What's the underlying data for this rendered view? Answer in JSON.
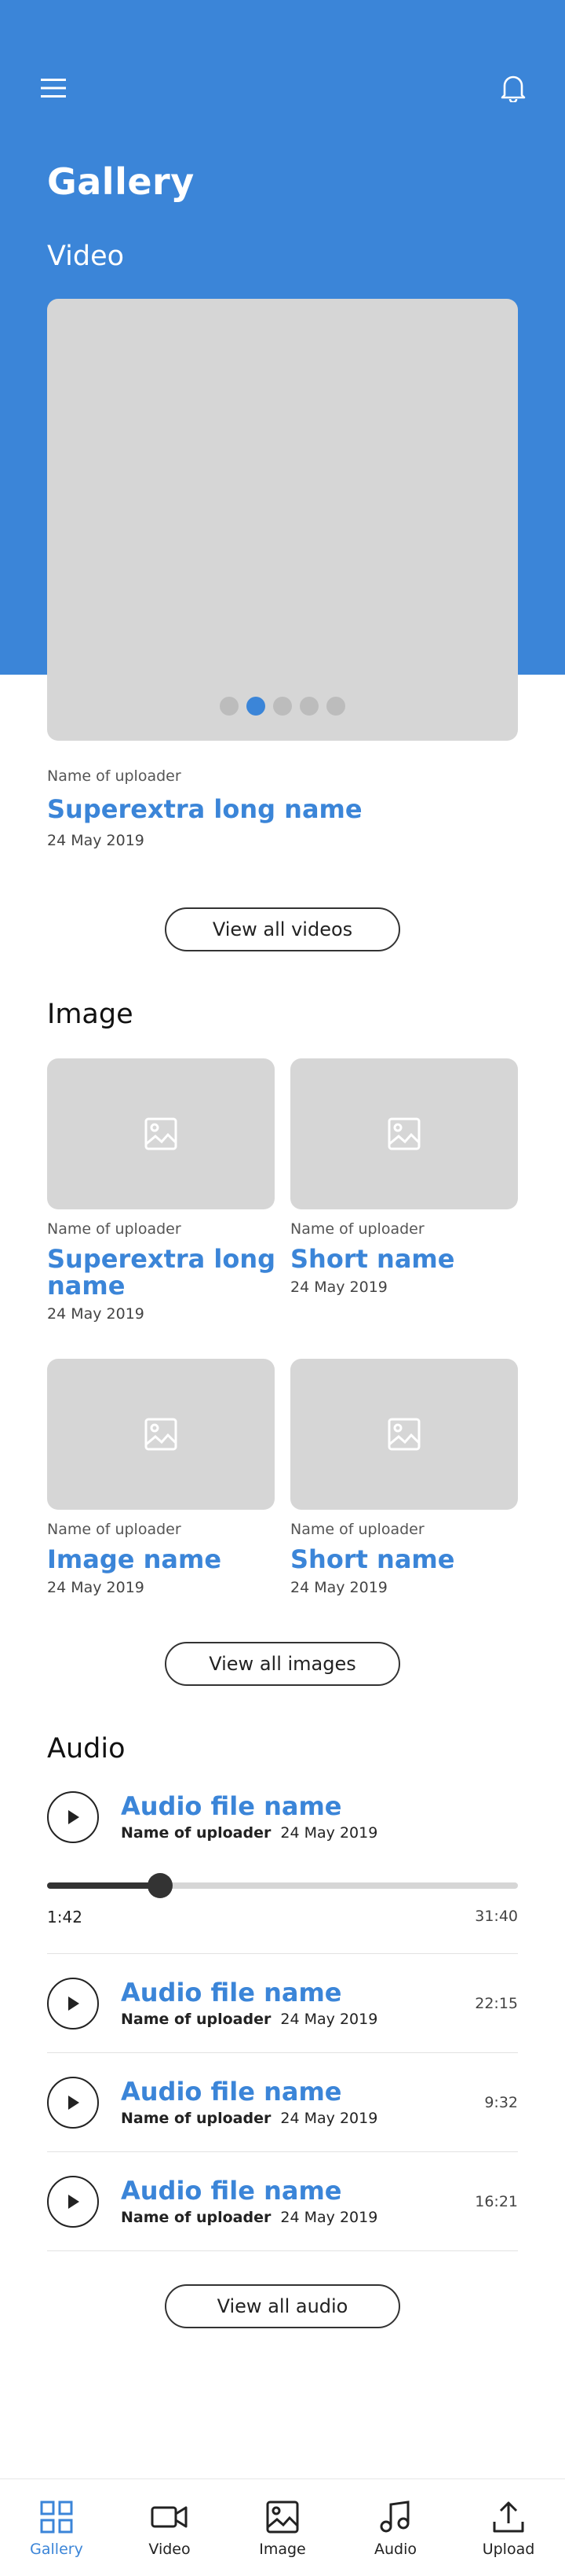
{
  "header": {
    "title": "Gallery",
    "menu_icon": "hamburger-icon",
    "bell_icon": "bell-icon"
  },
  "video": {
    "section_title": "Video",
    "carousel": {
      "count": 5,
      "active_index": 1
    },
    "uploader": "Name of uploader",
    "title": "Superextra long name",
    "date": "24 May 2019",
    "view_all_label": "View all videos"
  },
  "image": {
    "section_title": "Image",
    "items": [
      {
        "uploader": "Name of uploader",
        "title": "Superextra long name",
        "date": "24 May 2019"
      },
      {
        "uploader": "Name of uploader",
        "title": "Short name",
        "date": "24 May 2019"
      },
      {
        "uploader": "Name of uploader",
        "title": "Image name",
        "date": "24 May 2019"
      },
      {
        "uploader": "Name of uploader",
        "title": "Short name",
        "date": "24 May 2019"
      }
    ],
    "view_all_label": "View all images"
  },
  "audio": {
    "section_title": "Audio",
    "now_playing": {
      "title": "Audio file name",
      "uploader": "Name of uploader",
      "date": "24 May 2019",
      "current_time": "1:42",
      "total_time": "31:40",
      "progress": 0.24
    },
    "items": [
      {
        "title": "Audio file name",
        "uploader": "Name of uploader",
        "date": "24 May 2019",
        "duration": "22:15"
      },
      {
        "title": "Audio file name",
        "uploader": "Name of uploader",
        "date": "24 May 2019",
        "duration": "9:32"
      },
      {
        "title": "Audio file name",
        "uploader": "Name of uploader",
        "date": "24 May 2019",
        "duration": "16:21"
      }
    ],
    "view_all_label": "View all audio"
  },
  "nav": {
    "items": [
      {
        "label": "Gallery",
        "icon": "grid-icon",
        "active": true
      },
      {
        "label": "Video",
        "icon": "video-camera-icon",
        "active": false
      },
      {
        "label": "Image",
        "icon": "image-icon",
        "active": false
      },
      {
        "label": "Audio",
        "icon": "music-note-icon",
        "active": false
      },
      {
        "label": "Upload",
        "icon": "upload-icon",
        "active": false
      }
    ]
  },
  "colors": {
    "accent": "#3b85d8",
    "placeholder": "#d6d6d6"
  }
}
